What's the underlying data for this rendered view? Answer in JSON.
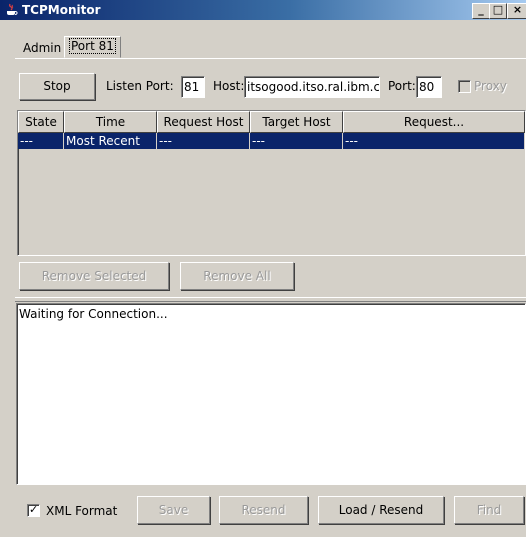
{
  "window": {
    "title": "TCPMonitor"
  },
  "tabs": [
    {
      "label": "Admin"
    },
    {
      "label": "Port 81"
    }
  ],
  "toolbar": {
    "stop_label": "Stop",
    "listen_port_label": "Listen Port:",
    "listen_port_value": "81",
    "host_label": "Host:",
    "host_value": "itsogood.itso.ral.ibm.c",
    "port_label": "Port:",
    "port_value": "80",
    "proxy_label": "Proxy"
  },
  "table": {
    "columns": [
      "State",
      "Time",
      "Request Host",
      "Target Host",
      "Request..."
    ],
    "rows": [
      {
        "state": "---",
        "time": "Most Recent",
        "request_host": "---",
        "target_host": "---",
        "request": "---"
      }
    ]
  },
  "buttons": {
    "remove_selected": "Remove Selected",
    "remove_all": "Remove All"
  },
  "log": {
    "text": "Waiting for Connection..."
  },
  "bottom": {
    "xml_format_label": "XML Format",
    "xml_format_checked": true,
    "save_label": "Save",
    "resend_label": "Resend",
    "load_resend_label": "Load / Resend",
    "find_label": "Find"
  }
}
